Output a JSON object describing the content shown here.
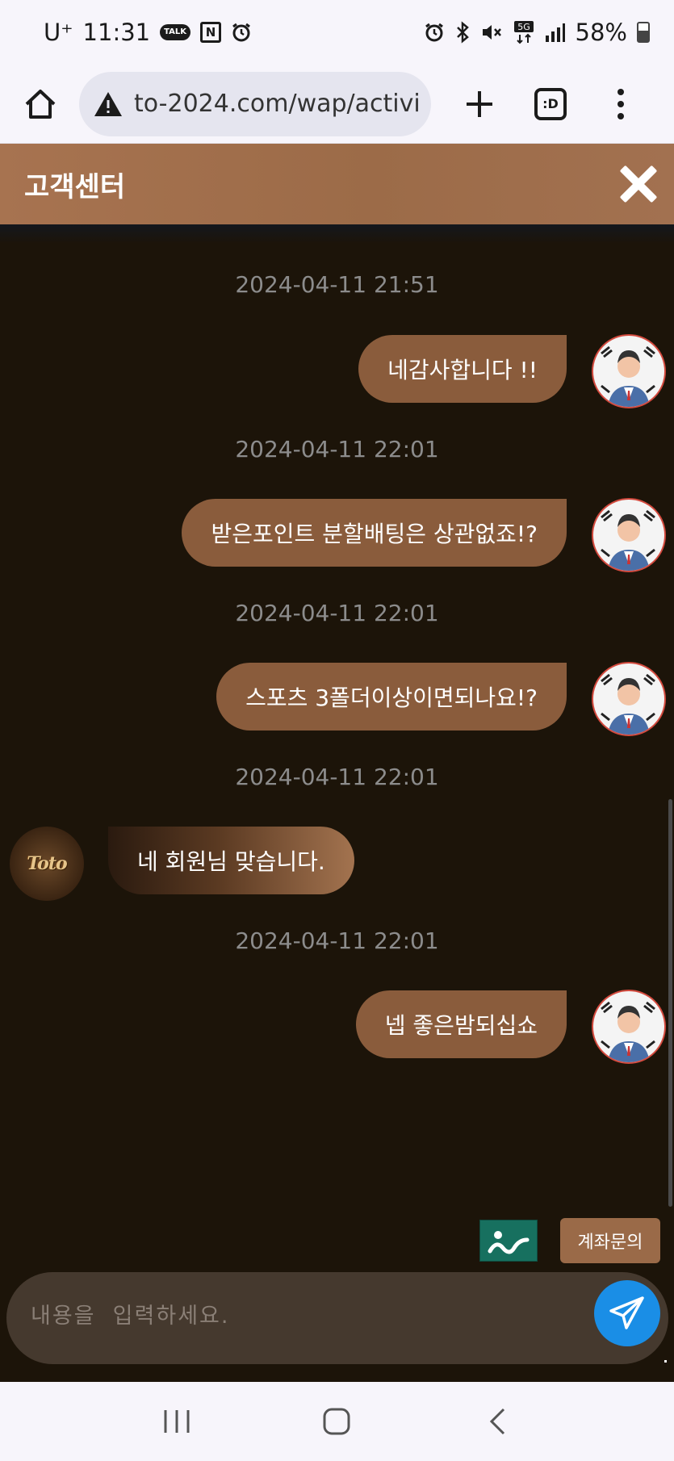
{
  "status_bar": {
    "carrier": "U⁺",
    "time": "11:31",
    "battery": "58%"
  },
  "browser": {
    "url": "to-2024.com/wap/activit",
    "tabs_label": ":D"
  },
  "chat": {
    "title": "고객센터",
    "messages": [
      {
        "timestamp": "2024-04-11 21:51",
        "text": "네감사합니다 !!",
        "from": "user"
      },
      {
        "timestamp": "2024-04-11 22:01",
        "text": "받은포인트 분할배팅은 상관없죠!?",
        "from": "user"
      },
      {
        "timestamp": "2024-04-11 22:01",
        "text": "스포츠 3폴더이상이면되나요!?",
        "from": "user"
      },
      {
        "timestamp": "2024-04-11 22:01",
        "text": "네 회원님 맞습니다.",
        "from": "agent"
      },
      {
        "timestamp": "2024-04-11 22:01",
        "text": "넵 좋은밤되십쇼",
        "from": "user"
      }
    ],
    "agent_logo_text": "Toto",
    "account_inquiry_label": "계좌문의",
    "input_placeholder": "내용을  입력하세요."
  },
  "colors": {
    "header": "#a77350",
    "background": "#1c1409",
    "sent_bubble": "#8a5c3c",
    "send_button": "#1a8ee6",
    "image_button": "#17705f"
  }
}
